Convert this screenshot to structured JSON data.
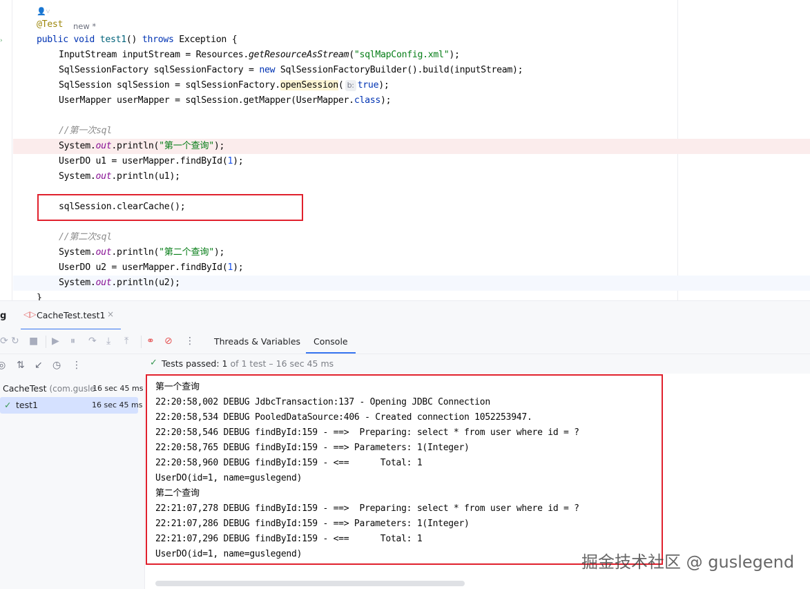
{
  "editor": {
    "usage_hint": "new *",
    "annotation": "@Test",
    "lines": {
      "l_public": "public",
      "l_void": "void",
      "l_test1": "test1",
      "l_paren": "() ",
      "l_throws": "throws",
      "l_exc": " Exception {",
      "l2_a": "InputStream inputStream = Resources.",
      "l2_b": "getResourceAsStream",
      "l2_c": "(",
      "l2_str": "\"sqlMapConfig.xml\"",
      "l2_d": ");",
      "l3_a": "SqlSessionFactory sqlSessionFactory = ",
      "l3_new": "new",
      "l3_b": " SqlSessionFactoryBuilder().build(inputStream);",
      "l4_a": "SqlSession sqlSession = sqlSessionFactory.",
      "l4_open": "openSession",
      "l4_paren": "(",
      "l4_hint": "b:",
      "l4_true": "true",
      "l4_end": ");",
      "l5_a": "UserMapper userMapper = sqlSession.getMapper(UserMapper.",
      "l5_class": "class",
      "l5_end": ");",
      "cmt1": "//第一次sql",
      "sys": "System.",
      "out": "out",
      "println": ".println(",
      "str1": "\"第一个查询\"",
      "end": ");",
      "l8_a": "UserDO u1 = userMapper.findById(",
      "one": "1",
      "l9_arg": "u1",
      "clear": "sqlSession.clearCache();",
      "cmt2": "//第二次sql",
      "str2": "\"第二个查询\"",
      "l13_a": "UserDO u2 = userMapper.findById(",
      "l14_arg": "u2",
      "brace": "}"
    }
  },
  "tool_window": {
    "letter": "g",
    "session_tab": "CacheTest.test1",
    "tabs": [
      "Threads & Variables",
      "Console"
    ],
    "active_tab": "Console"
  },
  "status": {
    "passed_label": "Tests passed:",
    "passed_count": "1",
    "rest": "of 1 test – 16 sec 45 ms"
  },
  "tree": {
    "root_name": "CacheTest",
    "root_pkg": "(com.gusle",
    "root_time": "16 sec 45 ms",
    "child_name": "test1",
    "child_time": "16 sec 45 ms"
  },
  "console": {
    "lines": [
      "第一个查询",
      "22:20:58,002 DEBUG JdbcTransaction:137 - Opening JDBC Connection",
      "22:20:58,534 DEBUG PooledDataSource:406 - Created connection 1052253947.",
      "22:20:58,546 DEBUG findById:159 - ==>  Preparing: select * from user where id = ?",
      "22:20:58,765 DEBUG findById:159 - ==> Parameters: 1(Integer)",
      "22:20:58,960 DEBUG findById:159 - <==      Total: 1",
      "UserDO(id=1, name=guslegend)",
      "第二个查询",
      "22:21:07,278 DEBUG findById:159 - ==>  Preparing: select * from user where id = ?",
      "22:21:07,286 DEBUG findById:159 - ==> Parameters: 1(Integer)",
      "22:21:07,296 DEBUG findById:159 - <==      Total: 1",
      "UserDO(id=1, name=guslegend)"
    ]
  },
  "watermark": "掘金技术社区 @ guslegend",
  "colors": {
    "highlight_box": "#e0202c",
    "accent": "#3574f0",
    "pass_green": "#369650"
  }
}
